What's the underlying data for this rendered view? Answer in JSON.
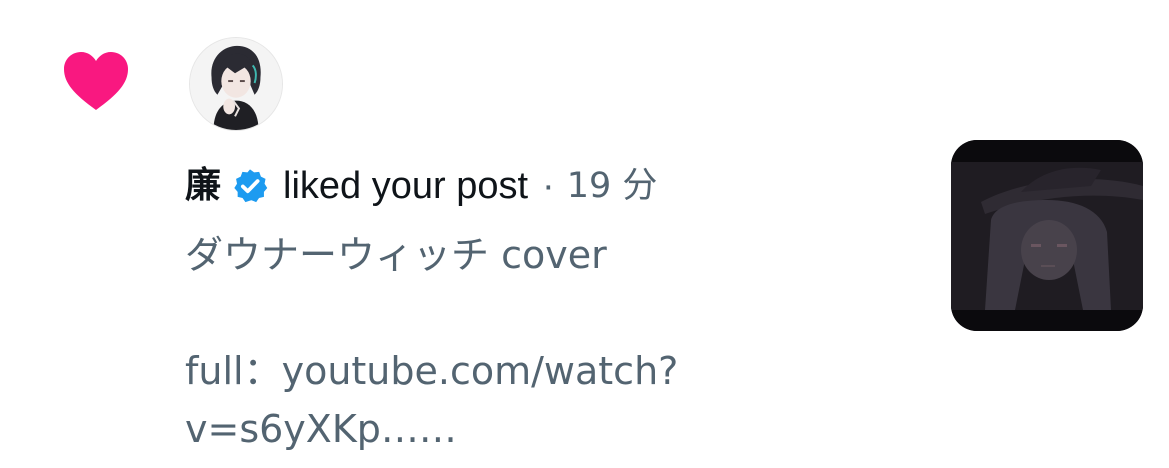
{
  "notification": {
    "type_icon": "heart-icon",
    "type_icon_color": "#f91880",
    "avatar_icon": "user-avatar",
    "username": "廉",
    "verified_badge": "verified-badge-icon",
    "verified_color": "#1d9bf0",
    "action_text": "liked your post",
    "separator": "·",
    "timestamp": "19 分",
    "post_text": "ダウナーウィッチ cover\n\nfull：youtube.com/watch?\nv=s6yXKp……",
    "media_thumbnail": "video-thumbnail"
  },
  "colors": {
    "primary_text": "#0f1419",
    "secondary_text": "#536471",
    "background": "#ffffff"
  }
}
